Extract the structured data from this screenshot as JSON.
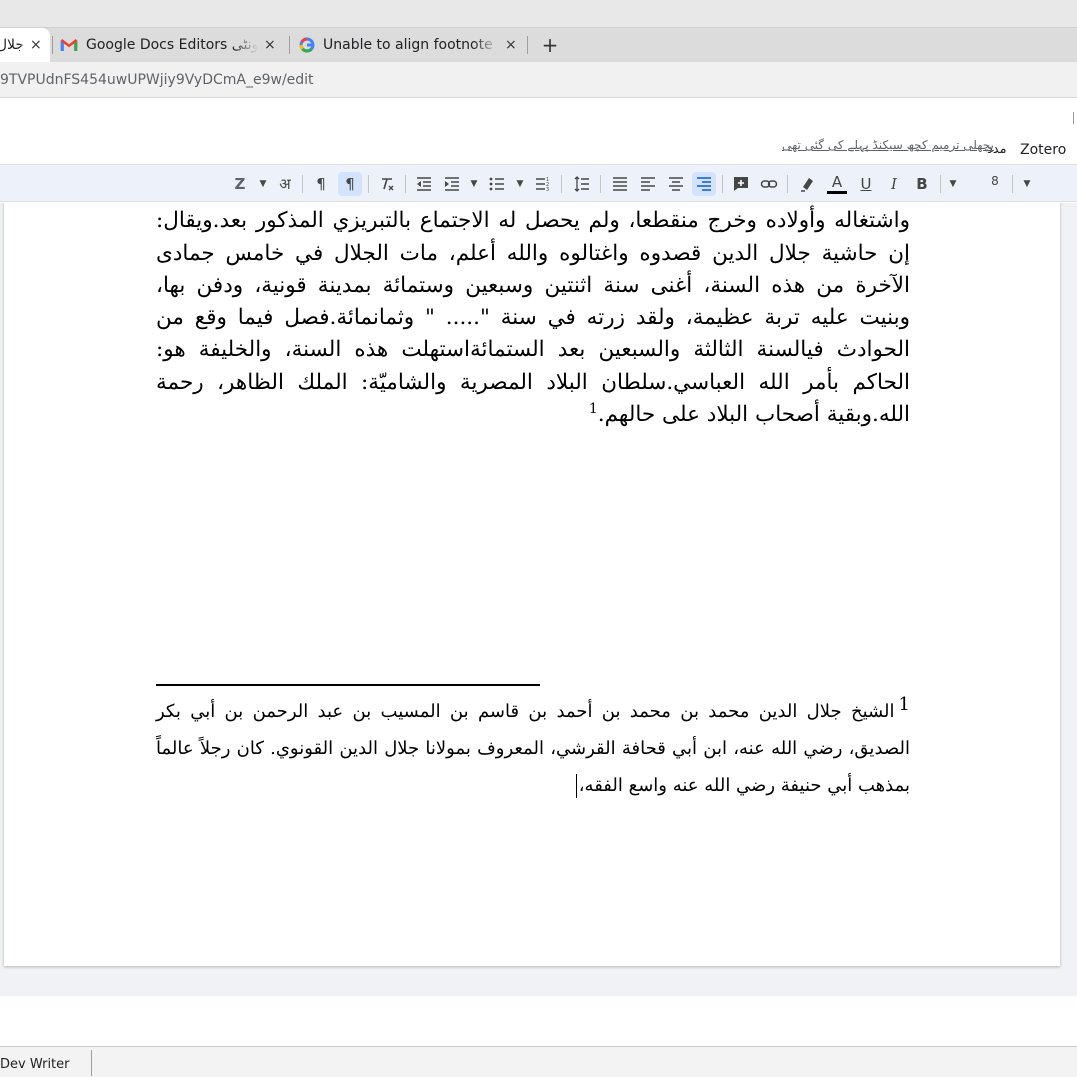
{
  "browser": {
    "tabs": [
      {
        "label": "جلال",
        "active": true
      },
      {
        "label": "Google Docs Editors یونٹی",
        "active": false,
        "icon": "gmail-icon"
      },
      {
        "label": "Unable to align footnote sc",
        "active": false,
        "icon": "google-icon"
      }
    ],
    "close_glyph": "×",
    "new_tab_glyph": "+",
    "url": "9TVPUdnFS454uwUPWjiy9VyDCmA_e9w/edit"
  },
  "docs": {
    "menus": [
      "Zotero",
      "مدد"
    ],
    "last_edit": "پچھلی ترمیم کچھ سیکنڈ پہلے کی گئی تھی",
    "font_size": "8"
  },
  "document": {
    "body_paragraph": "ثم قام وخرج من عنده: فقام الشيخ جلال الدين وخرج وراءه ولم يجده، ثم ترك كتبه واشتغاله وأولاده وخرج منقطعا، ولم يحصل له الاجتماع بالتبريزي المذكور بعد.ويقال: إن حاشية جلال الدين قصدوه واغتالوه والله أعلم، مات الجلال في خامس جمادى الآخرة من هذه السنة، أغنى سنة اثنتين وسبعين وستمائة بمدينة قونية، ودفن بها، وبنيت عليه تربة عظيمة، ولقد زرته في سنة \"..... \" وثمانمائة.فصل فيما وقع من الحوادث فيالسنة الثالثة والسبعين بعد الستمائةاستهلت هذه السنة، والخليفة هو: الحاكم بأمر الله العباسي.سلطان البلاد المصرية والشاميّة: الملك الظاهر، رحمة الله.وبقية أصحاب البلاد على حالهم.",
    "footnote_ref": "1",
    "footnote_number": "1",
    "footnote_text": "الشيخ جلال الدين محمد بن محمد بن أحمد بن قاسم بن المسيب بن عبد الرحمن بن أبي بكر الصديق، رضي الله عنه، ابن أبي قحافة القرشي، المعروف بمولانا جلال الدين القونوي. كان رجلاً عالماً بمذهب أبي حنيفة رضي الله عنه واسع الفقه،"
  },
  "statusbar": {
    "app_label": "Dev Writer"
  },
  "colors": {
    "toolbar_bg": "#edf2fa",
    "active_button": "#d3e3fd",
    "gmail_red": "#ea4335",
    "text": "#000000"
  }
}
